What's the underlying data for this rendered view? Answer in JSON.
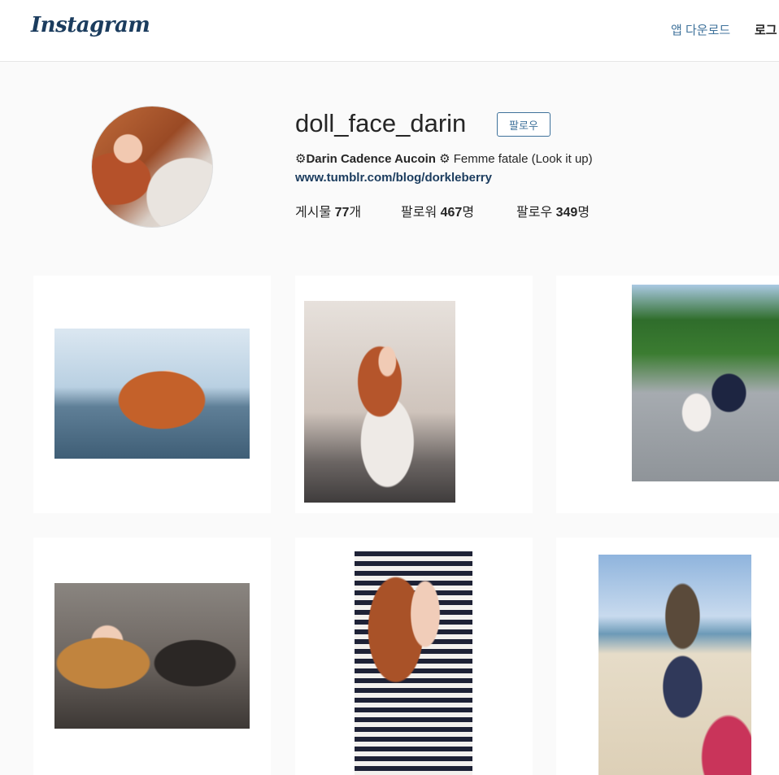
{
  "header": {
    "logo": "Instagram",
    "app_download": "앱 다운로드",
    "login": "로그"
  },
  "profile": {
    "username": "doll_face_darin",
    "follow_label": "팔로우",
    "full_name": "Darin Cadence Aucoin",
    "bio_prefix": "⚙",
    "bio_suffix": "⚙ Femme fatale (Look it up)",
    "link": "www.tumblr.com/blog/dorkleberry",
    "stats": {
      "posts_label": "게시물 ",
      "posts_value": "77",
      "posts_unit": "개",
      "followers_label": "팔로워 ",
      "followers_value": "467",
      "followers_unit": "명",
      "following_label": "팔로우 ",
      "following_value": "349",
      "following_unit": "명"
    }
  },
  "grid": {
    "photos": [
      {
        "subject": "selfie by the water",
        "colors": [
          "#a7c3d6",
          "#c96a2e"
        ]
      },
      {
        "subject": "selfie in restroom peace sign",
        "colors": [
          "#c4b8b0",
          "#b7572d"
        ]
      },
      {
        "subject": "couple outdoors",
        "colors": [
          "#2f6b2a",
          "#9aa0a5"
        ]
      },
      {
        "subject": "three friends in car",
        "colors": [
          "#5c5550",
          "#b8773f"
        ]
      },
      {
        "subject": "selfie striped top",
        "colors": [
          "#b0602e",
          "#e8dcd6"
        ]
      },
      {
        "subject": "beach with sun hat",
        "colors": [
          "#8fb4dd",
          "#e6dcc8"
        ]
      }
    ]
  }
}
